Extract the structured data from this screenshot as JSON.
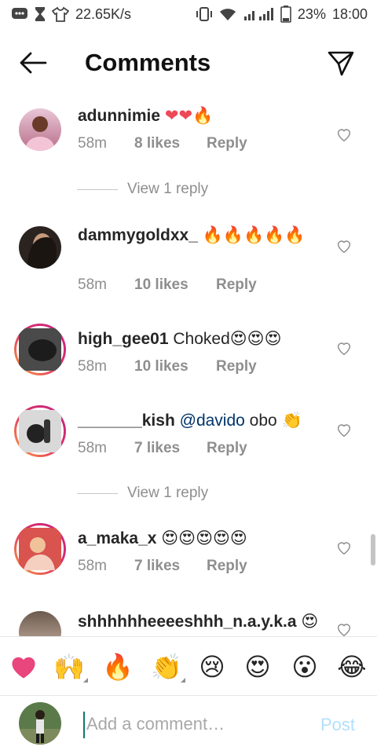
{
  "status_bar": {
    "speed": "22.65K/s",
    "battery": "23%",
    "time": "18:00"
  },
  "header": {
    "title": "Comments"
  },
  "comments": [
    {
      "username": "adunnimie",
      "body": "",
      "mention": "",
      "tail": "",
      "emoji": "❤❤🔥",
      "time": "58m",
      "likes": "8 likes",
      "reply": "Reply"
    },
    {
      "username": "dammygoldxx_",
      "body": "",
      "mention": "",
      "tail": "",
      "emoji": "🔥🔥🔥🔥🔥",
      "time": "58m",
      "likes": "10 likes",
      "reply": "Reply"
    },
    {
      "username": "high_gee01",
      "body": "Choked",
      "mention": "",
      "tail": "",
      "emoji": "😍😍😍",
      "time": "58m",
      "likes": "10 likes",
      "reply": "Reply"
    },
    {
      "username": "_______kish",
      "body": "",
      "mention": "@davido",
      "tail": "obo",
      "emoji": "👏",
      "time": "58m",
      "likes": "7 likes",
      "reply": "Reply"
    },
    {
      "username": "a_maka_x",
      "body": "",
      "mention": "",
      "tail": "",
      "emoji": "😍😍😍😍😍",
      "time": "58m",
      "likes": "7 likes",
      "reply": "Reply"
    },
    {
      "username": "shhhhhheeeeshhh_n.a.y.k.a",
      "body": "",
      "mention": "",
      "tail": "",
      "emoji": "😍😍😍",
      "time": "",
      "likes": "",
      "reply": ""
    }
  ],
  "view_replies": [
    "View 1 reply",
    "View 1 reply"
  ],
  "emoji_bar": [
    "❤",
    "🙌",
    "🔥",
    "👏",
    "😢",
    "😍",
    "😮",
    "😂"
  ],
  "composer": {
    "placeholder": "Add a comment…",
    "post_label": "Post"
  },
  "colors": {
    "link": "#003569",
    "meta": "#8e8e8e",
    "post_disabled": "#b2dffc",
    "heart": "#ed4956"
  }
}
